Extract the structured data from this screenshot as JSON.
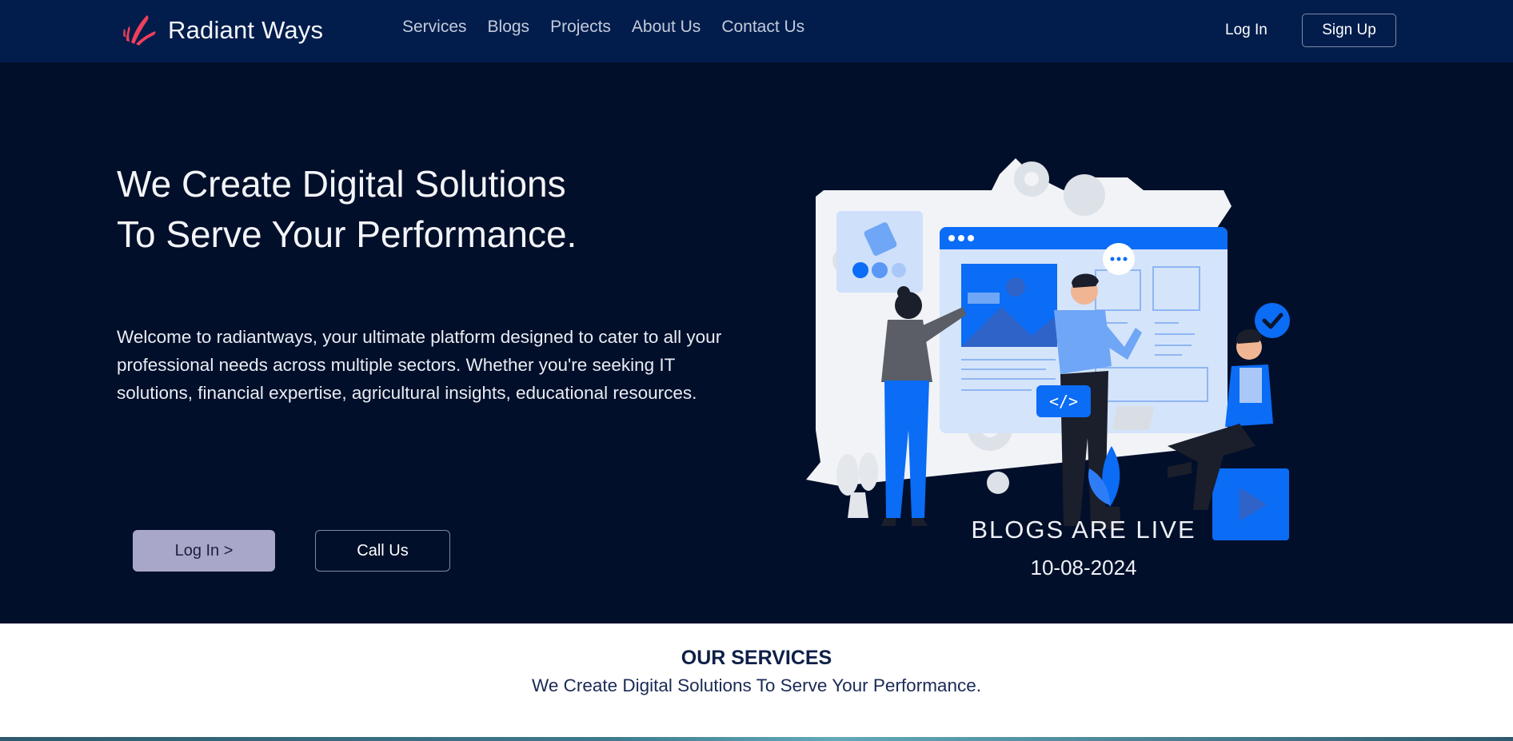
{
  "nav": {
    "brand": "Radiant Ways",
    "links": [
      "Services",
      "Blogs",
      "Projects",
      "About Us",
      "Contact Us"
    ],
    "login": "Log In",
    "signup": "Sign Up"
  },
  "hero": {
    "title_line1": "We Create Digital Solutions",
    "title_line2": "To Serve Your Performance.",
    "description": "Welcome to radiantways, your ultimate platform designed to cater to all your professional needs across multiple sectors. Whether you're seeking IT solutions, financial expertise, agricultural insights, educational resources.",
    "login_button": "Log In >",
    "call_button": "Call Us",
    "blogs_live": "BLOGS ARE LIVE",
    "blogs_date": "10-08-2024",
    "code_badge": "</>"
  },
  "services": {
    "title": "OUR SERVICES",
    "subtitle": "We Create Digital Solutions To Serve Your Performance."
  },
  "colors": {
    "navbar": "#021d4c",
    "hero_bg": "#020f2a",
    "accent_blue": "#0b6cf5",
    "brand_red": "#ef3f5b",
    "login_button": "#a9a7c9"
  },
  "icons": [
    "brand-logo-icon",
    "chevron-right-icon",
    "checkmark-badge-icon",
    "gear-icon",
    "play-icon"
  ]
}
